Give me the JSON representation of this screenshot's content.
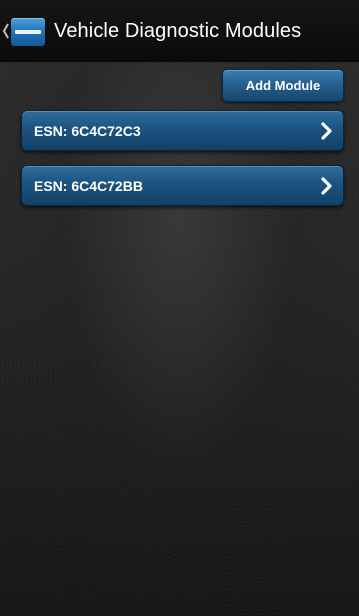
{
  "action_bar": {
    "title": "Vehicle Diagnostic Modules",
    "up_icon": "chevron-left-icon",
    "logo_icon": "app-logo-icon"
  },
  "toolbar": {
    "add_module_label": "Add Module"
  },
  "modules": [
    {
      "label": "ESN: 6C4C72C3",
      "icon": "chevron-right-icon"
    },
    {
      "label": "ESN: 6C4C72BB",
      "icon": "chevron-right-icon"
    }
  ],
  "colors": {
    "action_bar_bg": "#0f0f0f",
    "button_blue": "#1d5684",
    "text": "#ffffff"
  }
}
